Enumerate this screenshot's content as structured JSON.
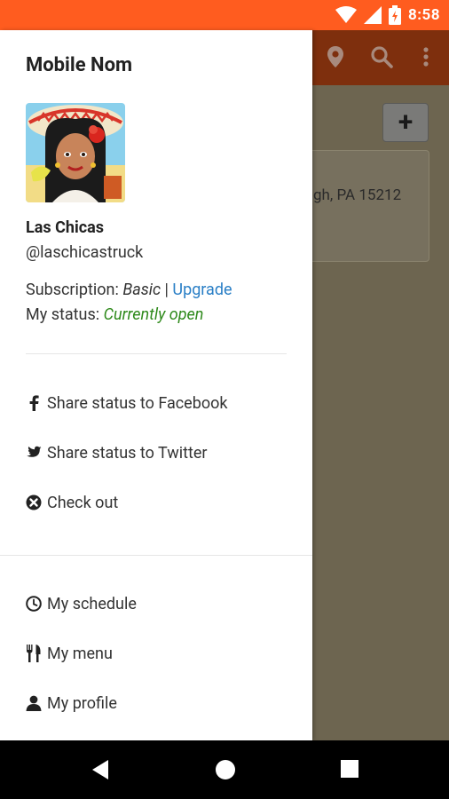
{
  "status_bar": {
    "time": "8:58"
  },
  "drawer": {
    "title": "Mobile Nom",
    "business_name": "Las Chicas",
    "handle": "@laschicastruck",
    "subscription_label": "Subscription: ",
    "subscription_value": "Basic",
    "separator": " | ",
    "upgrade_label": "Upgrade",
    "status_label": "My status: ",
    "status_value": "Currently open",
    "share_items": [
      {
        "icon": "facebook-icon",
        "label": "Share status to Facebook"
      },
      {
        "icon": "twitter-icon",
        "label": "Share status to Twitter"
      },
      {
        "icon": "checkout-icon",
        "label": "Check out"
      }
    ],
    "nav_items": [
      {
        "icon": "clock-icon",
        "label": "My schedule"
      },
      {
        "icon": "utensils-icon",
        "label": "My menu"
      },
      {
        "icon": "user-icon",
        "label": "My profile"
      }
    ]
  },
  "background_app": {
    "add_label": "+",
    "card_address": "gh, PA 15212"
  },
  "colors": {
    "status_bar": "#ff5c1f",
    "app_toolbar": "#7e2f0d",
    "link": "#2a7fc6",
    "open_status": "#2f8a1c"
  }
}
